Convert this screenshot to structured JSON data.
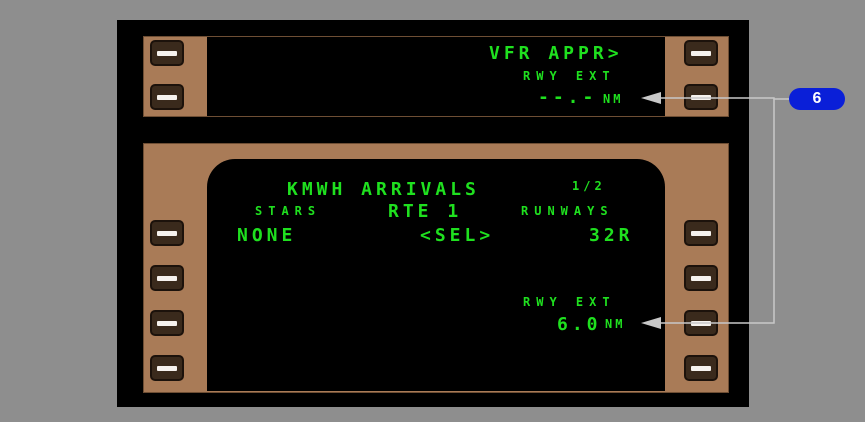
{
  "upper_display": {
    "vfr_appr": "VFR APPR>",
    "rwy_ext_label": "RWY EXT",
    "rwy_ext_value": "--.-",
    "rwy_ext_unit": "NM"
  },
  "lower_display": {
    "title": "KMWH ARRIVALS",
    "page": "1/2",
    "stars_label": "STARS",
    "route": "RTE 1",
    "runways_label": "RUNWAYS",
    "stars_value": "NONE",
    "sel": "<SEL>",
    "runway_value": "32R",
    "rwy_ext_label": "RWY EXT",
    "rwy_ext_value": "6.0",
    "rwy_ext_unit": "NM"
  },
  "callout": {
    "number": "6",
    "color": "#0a1fd8"
  },
  "colors": {
    "display_text": "#1fe01f",
    "bezel": "#a97b57",
    "background": "#8e8e8e"
  }
}
